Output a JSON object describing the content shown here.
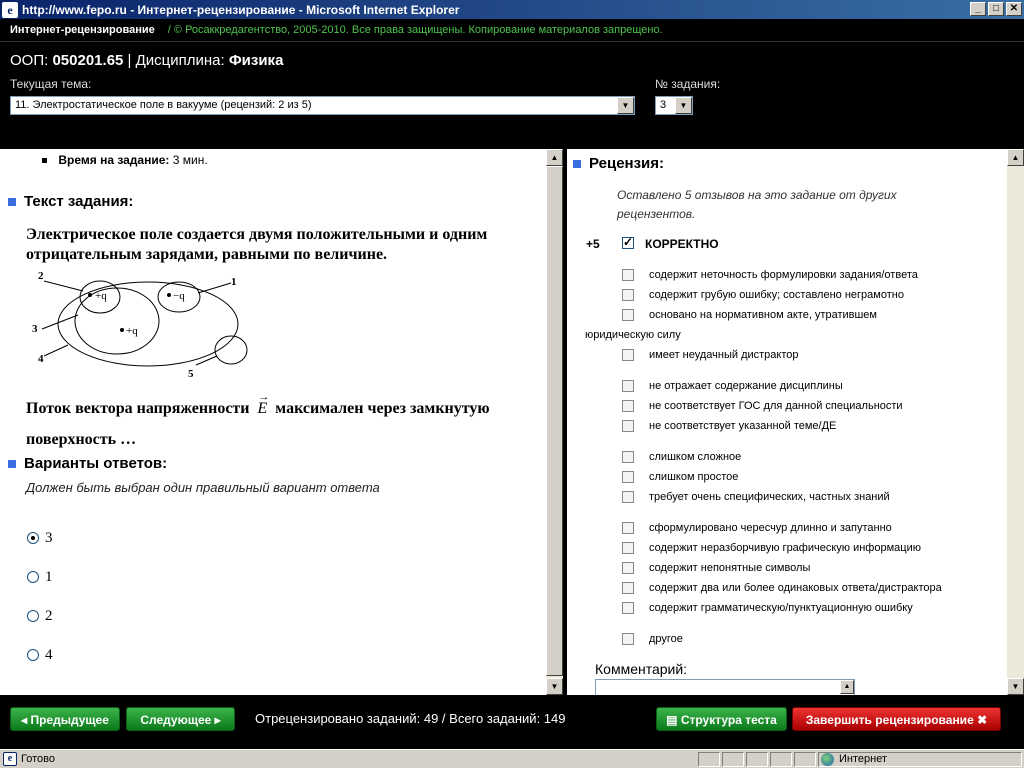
{
  "window": {
    "title": "http://www.fepo.ru - Интернет-рецензирование - Microsoft Internet Explorer",
    "min": "_",
    "max": "□",
    "close": "✕"
  },
  "header": {
    "app_name": "Интернет-рецензирование",
    "copyright": "/  © Росаккредагентство, 2005-2010. Все права защищены. Копирование материалов запрещено.",
    "oop_label": "ООП:",
    "oop_value": "050201.65",
    "sep": "|",
    "discipline_label": "Дисциплина:",
    "discipline_value": "Физика",
    "topic_label": "Текущая тема:",
    "topic_value": "11. Электростатическое поле в вакууме  (рецензий: 2 из 5)",
    "task_num_label": "№ задания:",
    "task_num_value": "3"
  },
  "task": {
    "time_label": "Время на задание:",
    "time_value": "3 мин.",
    "text_title": "Текст задания:",
    "text_p1": "Электрическое поле создается двумя положительными и одним отрицательным зарядами, равными по величине.",
    "text_p2a": "Поток вектора напряженности",
    "vector": "E",
    "text_p2b": "максимален через замкнутую поверхность …",
    "figure": {
      "labels": [
        "1",
        "2",
        "3",
        "4",
        "5"
      ],
      "charges": [
        "+q",
        "−q",
        "+q"
      ]
    },
    "answers_title": "Варианты ответов:",
    "answers_hint": "Должен быть выбран один правильный вариант ответа",
    "answers": [
      {
        "label": "3",
        "selected": true
      },
      {
        "label": "1",
        "selected": false
      },
      {
        "label": "2",
        "selected": false
      },
      {
        "label": "4",
        "selected": false
      }
    ]
  },
  "review": {
    "title": "Рецензия:",
    "note": "Оставлено 5 отзывов на это задание от других рецензентов.",
    "score": "+5",
    "correct_label": "КОРРЕКТНО",
    "items": [
      "содержит неточность формулировки задания/ответа",
      "содержит грубую ошибку; составлено неграмотно",
      "основано на нормативном акте, утратившем",
      "юридическую силу",
      "имеет неудачный дистрактор",
      "не отражает содержание дисциплины",
      "не соответствует ГОС для данной специальности",
      "не соответствует указанной теме/ДЕ",
      "слишком сложное",
      "слишком простое",
      "требует очень специфических, частных знаний",
      "сформулировано чересчур длинно и запутанно",
      "содержит неразборчивую графическую информацию",
      "содержит непонятные символы",
      "содержит два или более одинаковых ответа/дистрактора",
      "содержит грамматическую/пунктуационную ошибку",
      "другое"
    ],
    "comment_label": "Комментарий:"
  },
  "toolbar": {
    "prev": "◂ Предыдущее",
    "next": "Следующее ▸",
    "counter": "Отрецензировано заданий: 49 / Всего заданий: 149",
    "structure": "▤ Структура теста",
    "finish": "Завершить рецензирование ✖"
  },
  "status": {
    "ready": "Готово",
    "zone": "Интернет"
  }
}
